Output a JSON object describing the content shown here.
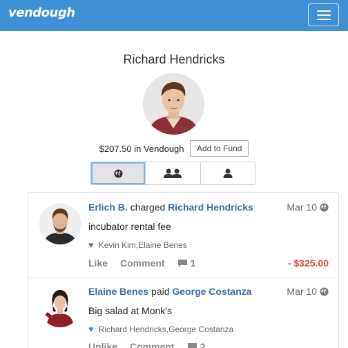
{
  "navbar": {
    "brand": "vendough",
    "menu_icon": "hamburger-icon",
    "bar_color": "#3f90d5"
  },
  "profile": {
    "name": "Richard Hendricks",
    "balance_text": "$207.50 in Vendough",
    "add_fund_label": "Add to Fund"
  },
  "tabs": [
    {
      "icon": "globe-icon",
      "active": true
    },
    {
      "icon": "friends-icon",
      "active": false
    },
    {
      "icon": "user-icon",
      "active": false
    }
  ],
  "feed": [
    {
      "actor": "Erlich B.",
      "verb": "charged",
      "target": "Richard Hendricks",
      "date": "Mar 10",
      "message": "incubator rental fee",
      "liked_by": [
        "Kevin Kim",
        "Elaine Benes"
      ],
      "liked_by_sep": ", ",
      "heart_color": "#777777",
      "like_label": "Like",
      "comment_label": "Comment",
      "comment_count": "1",
      "amount": "- $325.00",
      "amount_color": "#e5483e"
    },
    {
      "actor": "Elaine Benes",
      "verb": "paid",
      "target": "George Costanza",
      "date": "Mar 10",
      "message": "Big salad at Monk's",
      "liked_by": [
        "Richard Hendricks",
        "George Costanza"
      ],
      "liked_by_sep": ", ",
      "heart_color": "#3f90d5",
      "like_label": "Unlike",
      "comment_label": "Comment",
      "comment_count": "2",
      "amount": ""
    }
  ]
}
